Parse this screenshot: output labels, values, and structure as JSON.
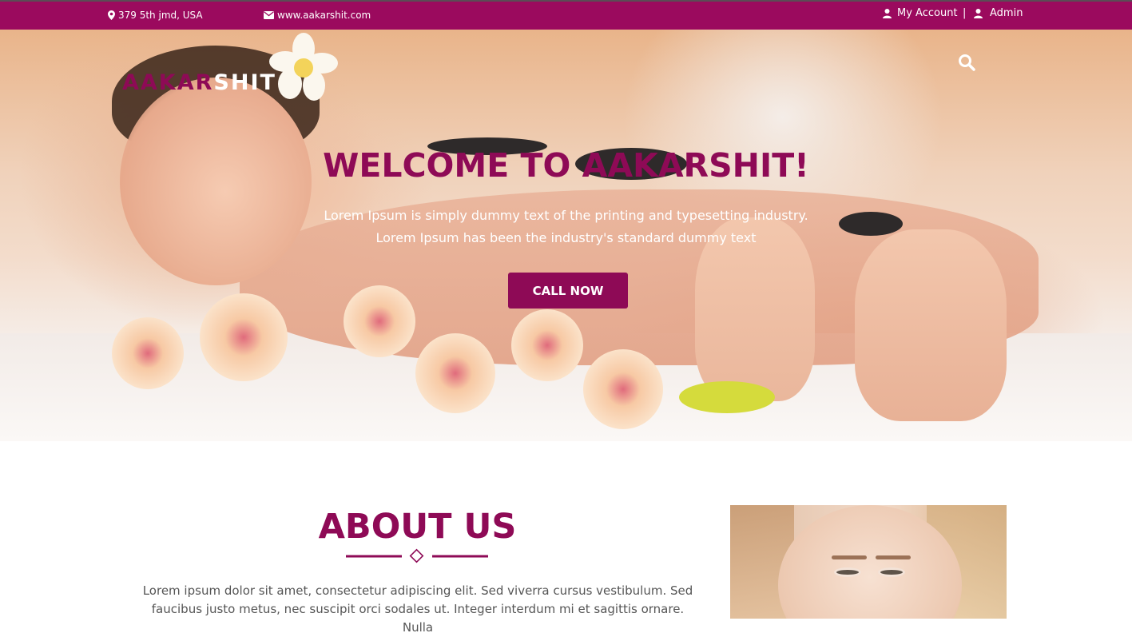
{
  "topbar": {
    "address": "379 5th jmd, USA",
    "email": "www.aakarshit.com",
    "my_account": "My Account",
    "separator": "|",
    "admin": "Admin"
  },
  "logo": {
    "part1": "AAKAR",
    "part2": "SHIT"
  },
  "hero": {
    "title": "WELCOME TO AAKARSHIT!",
    "subtitle_line1": "Lorem Ipsum is simply dummy text of the printing and typesetting industry.",
    "subtitle_line2": "Lorem Ipsum has been the industry's standard dummy text",
    "cta_label": "CALL NOW"
  },
  "about": {
    "title": "ABOUT US",
    "text": "Lorem ipsum dolor sit amet, consectetur adipiscing elit. Sed viverra cursus vestibulum. Sed faucibus justo metus, nec suscipit orci sodales ut. Integer interdum mi et sagittis ornare. Nulla"
  },
  "icons": {
    "address": "map-marker-icon",
    "email": "envelope-icon",
    "account": "user-icon",
    "admin": "user-icon",
    "search": "search-icon",
    "divider": "diamond-icon"
  },
  "colors": {
    "brand": "#9b0a5e",
    "accent": "#8e0a56"
  }
}
